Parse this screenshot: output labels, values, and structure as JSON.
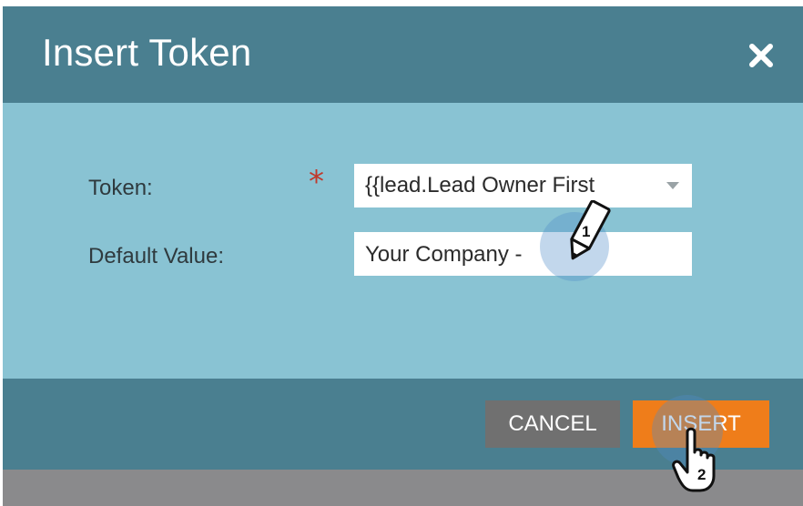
{
  "dialog": {
    "title": "Insert Token",
    "close_icon": "close-icon",
    "colors": {
      "header": "#4a7f90",
      "body": "#89c3d3",
      "cancel": "#707070",
      "insert": "#ef7d1a",
      "required": "#c0392b"
    }
  },
  "form": {
    "token_label": "Token:",
    "required_mark": "*",
    "token_value": "{{lead.Lead Owner First",
    "default_label": "Default Value:",
    "default_value": "Your Company -"
  },
  "footer": {
    "cancel_label": "CANCEL",
    "insert_label": "INSERT"
  },
  "annotations": {
    "step1": "1",
    "step2": "2"
  }
}
